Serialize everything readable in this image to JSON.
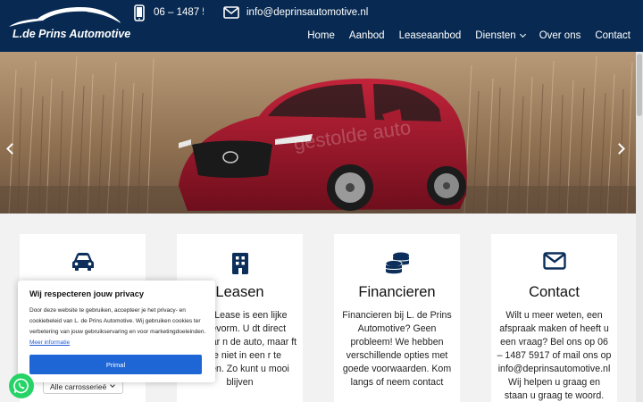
{
  "header": {
    "logo_text": "L.de Prins Automotive",
    "phone": "06 – 1487 5917",
    "email": "info@deprinsautomotive.nl"
  },
  "nav": {
    "items": [
      {
        "label": "Home"
      },
      {
        "label": "Aanbod"
      },
      {
        "label": "Leaseaanbod"
      },
      {
        "label": "Diensten"
      },
      {
        "label": "Over ons"
      },
      {
        "label": "Contact"
      }
    ]
  },
  "hero": {
    "watermark": "gestolde auto"
  },
  "cards": [
    {
      "icon": "car-icon",
      "title": "",
      "text": ""
    },
    {
      "icon": "building-icon",
      "title": "Leasen",
      "text": "ncial Lease is een lijke leasevorm. U dt direct eigenaar n de auto, maar ft deze niet in een r te betalen. Zo kunt u mooi blijven"
    },
    {
      "icon": "coins-icon",
      "title": "Financieren",
      "text": "Financieren bij L. de Prins Automotive? Geen probleem! We hebben verschillende opties met goede voorwaarden. Kom langs of neem contact"
    },
    {
      "icon": "envelope-icon",
      "title": "Contact",
      "text": "Wilt u meer weten, een afspraak maken of heeft u een vraag? Bel ons op 06 – 1487 5917 of mail ons op info@deprinsautomotive.nl Wij helpen u graag en staan u graag te woord."
    }
  ],
  "cookie": {
    "title": "Wij respecteren jouw privacy",
    "body": "Door deze website te gebruiken, accepteer je het privacy- en cookiebeleid van L. de Prins Automotive. Wij gebruiken cookies ter verbetering van jouw gebruikservaring en voor marketingdoeleinden.",
    "link": "Meer informatie",
    "button": "Primal"
  },
  "filter": {
    "selected": "Alle carrosserieë"
  },
  "colors": {
    "header_bg": "#082a52",
    "accent": "#1e66d6",
    "icon_navy": "#0b2f5a",
    "whatsapp": "#25d366"
  }
}
